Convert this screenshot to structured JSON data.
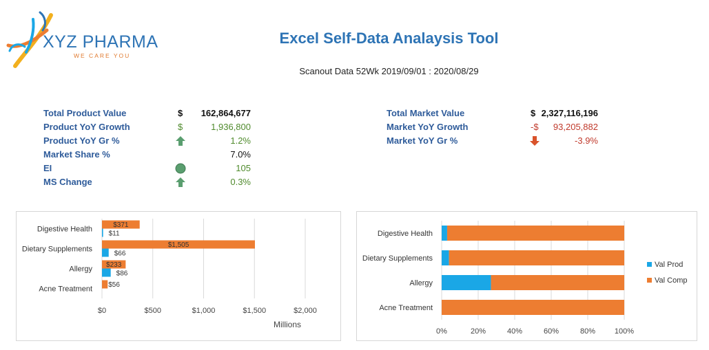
{
  "logo": {
    "name": "XYZ PHARMA",
    "tagline": "WE CARE YOU"
  },
  "header": {
    "title": "Excel Self-Data Analaysis Tool",
    "subtitle": "Scanout Data 52Wk 2019/09/01 : 2020/08/29"
  },
  "kpis_left": [
    {
      "label": "Total Product Value",
      "prefix": "$",
      "value": "162,864,677",
      "icon": "none",
      "color": "#111111"
    },
    {
      "label": "Product YoY Growth",
      "prefix": "$",
      "value": "1,936,800",
      "icon": "none",
      "color": "#4f8a2c"
    },
    {
      "label": "Product YoY Gr %",
      "prefix": "",
      "value": "1.2%",
      "icon": "arrow-up-icon",
      "color": "#4f8a2c"
    },
    {
      "label": "Market Share %",
      "prefix": "",
      "value": "7.0%",
      "icon": "none",
      "color": "#111111"
    },
    {
      "label": "EI",
      "prefix": "",
      "value": "105",
      "icon": "circle-icon",
      "color": "#4f8a2c"
    },
    {
      "label": "MS Change",
      "prefix": "",
      "value": "0.3%",
      "icon": "arrow-up-icon",
      "color": "#4f8a2c"
    }
  ],
  "kpis_right": [
    {
      "label": "Total Market Value",
      "prefix": "$",
      "value": "2,327,116,196",
      "icon": "none",
      "color": "#111111"
    },
    {
      "label": "Market YoY Growth",
      "prefix": "-$",
      "value": "93,205,882",
      "icon": "none",
      "color": "#c0392b"
    },
    {
      "label": "Market YoY Gr %",
      "prefix": "",
      "value": "-3.9%",
      "icon": "arrow-down-icon",
      "color": "#c0392b"
    }
  ],
  "colors": {
    "orange": "#ed7d31",
    "blue": "#1aa7e6",
    "title_blue": "#2e74b5",
    "icon_green": "#5a9e6f",
    "icon_red": "#d9532b"
  },
  "chart_data": [
    {
      "type": "bar",
      "orientation": "horizontal",
      "categories": [
        "Digestive Health",
        "Dietary Supplements",
        "Allergy",
        "Acne Treatment"
      ],
      "series": [
        {
          "values": [
            371,
            1505,
            233,
            56
          ],
          "labels": [
            "$371",
            "$1,505",
            "$233",
            "$56"
          ],
          "color": "#ed7d31"
        },
        {
          "values": [
            11,
            66,
            86,
            0
          ],
          "labels": [
            "$11",
            "$66",
            "$86",
            ""
          ],
          "color": "#1aa7e6"
        }
      ],
      "xlim": [
        0,
        2000
      ],
      "xticks": [
        "$0",
        "$500",
        "$1,000",
        "$1,500",
        "$2,000"
      ],
      "xlabel": "Millions",
      "grid": true
    },
    {
      "type": "bar",
      "orientation": "horizontal",
      "stacked": "percent",
      "categories": [
        "Digestive Health",
        "Dietary Supplements",
        "Allergy",
        "Acne Treatment"
      ],
      "series": [
        {
          "name": "Val Prod",
          "values": [
            3,
            4,
            27,
            0
          ],
          "color": "#1aa7e6"
        },
        {
          "name": "Val Comp",
          "values": [
            97,
            96,
            73,
            100
          ],
          "color": "#ed7d31"
        }
      ],
      "xlim": [
        0,
        100
      ],
      "xticks": [
        "0%",
        "20%",
        "40%",
        "60%",
        "80%",
        "100%"
      ],
      "legend": "right",
      "grid": true
    }
  ]
}
